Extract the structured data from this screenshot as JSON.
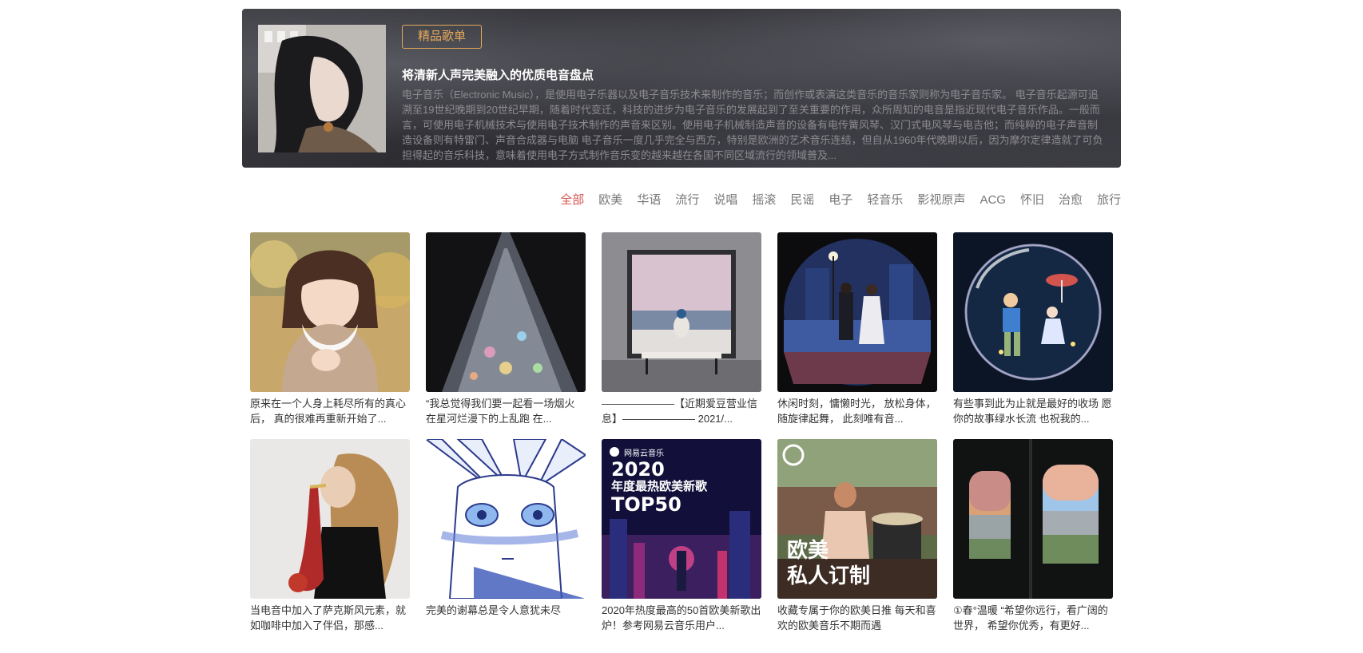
{
  "banner": {
    "badge": "精品歌单",
    "title": "将清新人声完美融入的优质电音盘点",
    "description": "电子音乐（Electronic Music），是使用电子乐器以及电子音乐技术来制作的音乐；而创作或表演这类音乐的音乐家则称为电子音乐家。 电子音乐起源可追溯至19世纪晚期到20世纪早期，随着时代变迁，科技的进步为电子音乐的发展起到了至关重要的作用，众所周知的电音是指近现代电子音乐作品。一般而言，可使用电子机械技术与使用电子技术制作的声音来区别。使用电子机械制造声音的设备有电传簧风琴、汉门式电风琴与电吉他；而纯粹的电子声音制造设备则有特雷门、声音合成器与电脑 电子音乐一度几乎完全与西方，特别是欧洲的艺术音乐连结，但自从1960年代晚期以后，因为摩尔定律造就了可负担得起的音乐科技，意味着使用电子方式制作音乐变的越来越在各国不同区域流行的领域普及..."
  },
  "categories": [
    "全部",
    "欧美",
    "华语",
    "流行",
    "说唱",
    "摇滚",
    "民谣",
    "电子",
    "轻音乐",
    "影视原声",
    "ACG",
    "怀旧",
    "治愈",
    "旅行"
  ],
  "active_category": "全部",
  "playlists": [
    {
      "title": "原来在一个人身上耗尽所有的真心后， 真的很难再重新开始了...",
      "art": "girl-scarf"
    },
    {
      "title": "“我总觉得我们要一起看一场烟火 在星河烂漫下的上乱跑 在...",
      "art": "veil"
    },
    {
      "title": "———————【近期爱豆营业信息】——————— 2021/...",
      "art": "window-sea"
    },
    {
      "title": "休闲时刻，慵懒时光， 放松身体，随旋律起舞， 此刻唯有音...",
      "art": "couple-night"
    },
    {
      "title": "有些事到此为止就是最好的收场 愿你的故事绿水长流 也祝我的...",
      "art": "bubble"
    },
    {
      "title": "当电音中加入了萨克斯风元素，就如咖啡中加入了伴侣，那感...",
      "art": "saxophone"
    },
    {
      "title": "完美的谢幕总是令人意犹未尽",
      "art": "anime-boy"
    },
    {
      "title": "2020年热度最高的50首欧美新歌出炉！参考网易云音乐用户...",
      "art": "top50",
      "cover_brand": "网易云音乐",
      "cover_lines": [
        "2020",
        "年度最热欧美新歌",
        "TOP50"
      ]
    },
    {
      "title": "收藏专属于你的欧美日推 每天和喜欢的欧美音乐不期而遇",
      "art": "drummer",
      "cover_lines": [
        "欧美",
        "私人订制"
      ]
    },
    {
      "title": "①春°温暖 “希望你远行，看广阔的世界， 希望你优秀，有更好...",
      "art": "train-windows"
    }
  ]
}
